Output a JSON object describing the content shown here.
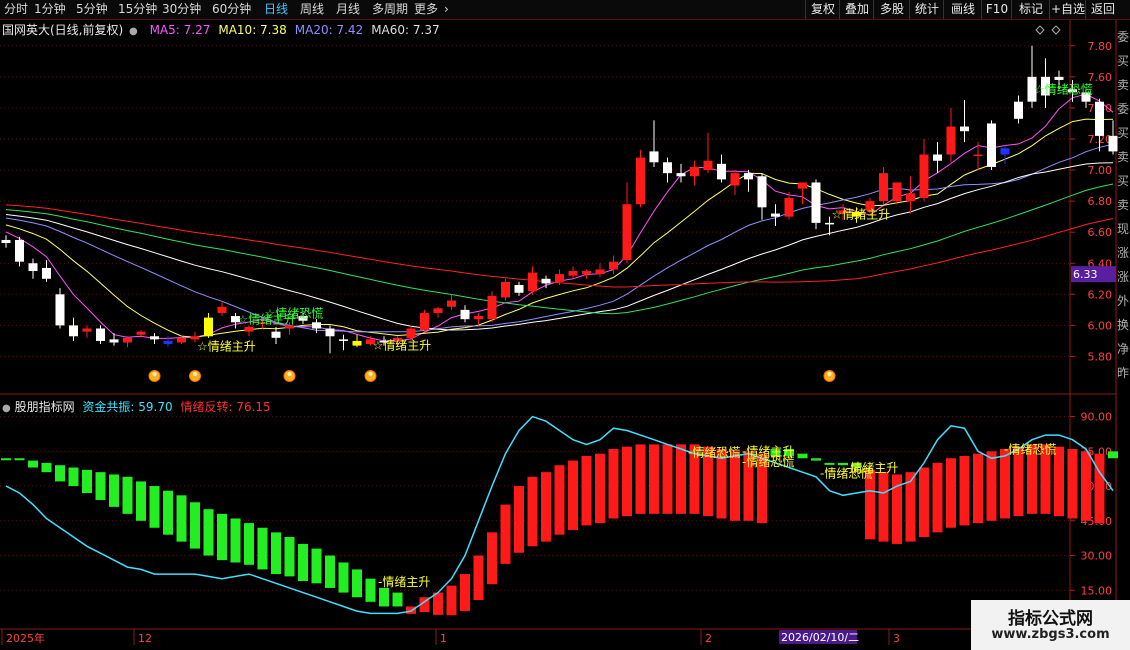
{
  "toolbar": {
    "periods": [
      {
        "label": "分时",
        "active": false
      },
      {
        "label": "1分钟",
        "active": false
      },
      {
        "label": "5分钟",
        "active": false
      },
      {
        "label": "15分钟",
        "active": false
      },
      {
        "label": "30分钟",
        "active": false
      },
      {
        "label": "60分钟",
        "active": false
      },
      {
        "label": "日线",
        "active": true
      },
      {
        "label": "周线",
        "active": false
      },
      {
        "label": "月线",
        "active": false
      },
      {
        "label": "多周期",
        "active": false
      },
      {
        "label": "更多",
        "active": false
      }
    ],
    "more_chevron": "›",
    "actions": [
      "复权",
      "叠加",
      "多股",
      "统计",
      "画线",
      "F10",
      "标记",
      "+自选",
      "返回"
    ]
  },
  "main_chart": {
    "stock_name": "国网英大(日线,前复权)",
    "ma_labels": [
      {
        "text": "MA5: 7.27",
        "color": "#ff55ff"
      },
      {
        "text": "MA10: 7.38",
        "color": "#ffff66"
      },
      {
        "text": "MA20: 7.42",
        "color": "#8f8fff"
      },
      {
        "text": "MA60: 7.37",
        "color": "#dddddd"
      }
    ],
    "price_ticks": [
      "7.80",
      "7.60",
      "7.40",
      "7.20",
      "7.00",
      "6.80",
      "6.60",
      "6.40",
      "6.20",
      "6.00",
      "5.80"
    ],
    "current_price": "6.33",
    "signals": {
      "rise": "情绪主升",
      "panic": "情绪恐慌"
    }
  },
  "indicator": {
    "name": "股朋指标网",
    "line1": {
      "text": "资金共振: 59.70",
      "color": "#40e0ff"
    },
    "line2": {
      "text": "情绪反转: 76.15",
      "color": "#ff3030"
    },
    "ticks": [
      "90.00",
      "75.00",
      "60.00",
      "45.00",
      "30.00",
      "15.00"
    ],
    "signals": {
      "rise": "情绪主升",
      "panic": "情绪恐慌"
    }
  },
  "date_axis": {
    "labels": [
      "2025年",
      "12",
      "1",
      "2",
      "3"
    ],
    "cursor_date": "2026/02/10/二"
  },
  "right_strip_text": [
    "委",
    "买",
    "卖",
    "委",
    "买",
    "卖",
    "买",
    "卖",
    "现",
    "涨",
    "涨",
    "外",
    "换",
    "净",
    "昨"
  ],
  "watermark": {
    "line1": "指标公式网",
    "line2": "www.zbgs3.com"
  },
  "chart_data": {
    "type": "candlestick",
    "ohlc_approx": [
      [
        6.55,
        6.58,
        6.5,
        6.53
      ],
      [
        6.55,
        6.57,
        6.38,
        6.41
      ],
      [
        6.4,
        6.43,
        6.3,
        6.35
      ],
      [
        6.37,
        6.42,
        6.28,
        6.3
      ],
      [
        6.2,
        6.24,
        5.98,
        6.0
      ],
      [
        6.0,
        6.05,
        5.9,
        5.93
      ],
      [
        5.96,
        6.0,
        5.92,
        5.98
      ],
      [
        5.98,
        6.0,
        5.88,
        5.9
      ],
      [
        5.91,
        5.95,
        5.87,
        5.89
      ],
      [
        5.89,
        5.93,
        5.86,
        5.92
      ],
      [
        5.94,
        5.97,
        5.93,
        5.96
      ],
      [
        5.93,
        5.95,
        5.88,
        5.91
      ],
      [
        5.88,
        5.93,
        5.86,
        5.9
      ],
      [
        5.89,
        5.93,
        5.88,
        5.92
      ],
      [
        5.91,
        5.96,
        5.89,
        5.93
      ],
      [
        5.93,
        6.08,
        5.92,
        6.05
      ],
      [
        6.08,
        6.15,
        6.06,
        6.12
      ],
      [
        6.06,
        6.08,
        5.98,
        6.02
      ],
      [
        5.96,
        6.0,
        5.93,
        5.99
      ],
      [
        6.01,
        6.04,
        5.98,
        6.02
      ],
      [
        5.96,
        5.99,
        5.88,
        5.92
      ],
      [
        5.98,
        6.02,
        5.94,
        6.0
      ],
      [
        6.06,
        6.08,
        6.01,
        6.03
      ],
      [
        6.02,
        6.04,
        5.95,
        5.98
      ],
      [
        5.98,
        6.0,
        5.82,
        5.93
      ],
      [
        5.91,
        5.94,
        5.84,
        5.9
      ],
      [
        5.9,
        5.94,
        5.86,
        5.87
      ],
      [
        5.88,
        5.93,
        5.87,
        5.91
      ],
      [
        5.9,
        5.93,
        5.87,
        5.89
      ],
      [
        5.9,
        5.93,
        5.87,
        5.92
      ],
      [
        5.92,
        6.0,
        5.9,
        5.98
      ],
      [
        5.97,
        6.1,
        5.96,
        6.08
      ],
      [
        6.08,
        6.12,
        6.05,
        6.11
      ],
      [
        6.12,
        6.2,
        6.1,
        6.16
      ],
      [
        6.1,
        6.13,
        6.02,
        6.04
      ],
      [
        6.04,
        6.08,
        6.0,
        6.06
      ],
      [
        6.04,
        6.22,
        6.02,
        6.19
      ],
      [
        6.18,
        6.3,
        6.16,
        6.28
      ],
      [
        6.26,
        6.28,
        6.19,
        6.21
      ],
      [
        6.22,
        6.38,
        6.2,
        6.34
      ],
      [
        6.3,
        6.32,
        6.24,
        6.27
      ],
      [
        6.28,
        6.36,
        6.26,
        6.33
      ],
      [
        6.32,
        6.38,
        6.3,
        6.35
      ],
      [
        6.33,
        6.36,
        6.3,
        6.35
      ],
      [
        6.33,
        6.4,
        6.31,
        6.36
      ],
      [
        6.36,
        6.45,
        6.33,
        6.41
      ],
      [
        6.42,
        6.92,
        6.4,
        6.78
      ],
      [
        6.78,
        7.13,
        6.76,
        7.08
      ],
      [
        7.12,
        7.32,
        7.02,
        7.05
      ],
      [
        7.05,
        7.08,
        6.92,
        6.98
      ],
      [
        6.98,
        7.04,
        6.92,
        6.96
      ],
      [
        6.96,
        7.06,
        6.9,
        7.02
      ],
      [
        7.0,
        7.24,
        6.98,
        7.06
      ],
      [
        7.04,
        7.1,
        6.92,
        6.94
      ],
      [
        6.9,
        7.0,
        6.84,
        6.98
      ],
      [
        6.98,
        7.0,
        6.86,
        6.94
      ],
      [
        6.96,
        6.98,
        6.68,
        6.76
      ],
      [
        6.72,
        6.78,
        6.64,
        6.7
      ],
      [
        6.7,
        6.86,
        6.68,
        6.82
      ],
      [
        6.88,
        6.92,
        6.78,
        6.92
      ],
      [
        6.92,
        6.94,
        6.62,
        6.66
      ],
      [
        6.66,
        6.7,
        6.58,
        6.65
      ],
      [
        6.72,
        6.78,
        6.68,
        6.74
      ],
      [
        6.73,
        6.76,
        6.66,
        6.7
      ],
      [
        6.74,
        6.82,
        6.72,
        6.8
      ],
      [
        6.8,
        7.02,
        6.78,
        6.98
      ],
      [
        6.8,
        6.92,
        6.78,
        6.92
      ],
      [
        6.8,
        6.96,
        6.72,
        6.85
      ],
      [
        6.82,
        7.2,
        6.8,
        7.1
      ],
      [
        7.1,
        7.18,
        6.98,
        7.06
      ],
      [
        7.1,
        7.4,
        7.05,
        7.28
      ],
      [
        7.28,
        7.45,
        7.18,
        7.25
      ],
      [
        7.1,
        7.18,
        7.0,
        7.1
      ],
      [
        7.3,
        7.32,
        7.0,
        7.02
      ],
      [
        7.1,
        7.16,
        7.04,
        7.14
      ],
      [
        7.44,
        7.48,
        7.3,
        7.33
      ],
      [
        7.6,
        7.8,
        7.4,
        7.44
      ],
      [
        7.6,
        7.72,
        7.4,
        7.48
      ],
      [
        7.6,
        7.64,
        7.52,
        7.58
      ],
      [
        7.52,
        7.58,
        7.44,
        7.5
      ],
      [
        7.5,
        7.52,
        7.4,
        7.44
      ],
      [
        7.44,
        7.46,
        7.12,
        7.22
      ],
      [
        7.22,
        7.32,
        7.1,
        7.12
      ]
    ],
    "ma_last": {
      "MA5": 7.27,
      "MA10": 7.38,
      "MA20": 7.42,
      "MA60": 7.37
    },
    "indicator_last": {
      "资金共振": 59.7,
      "情绪反转": 76.15
    },
    "y_range_price": [
      5.7,
      7.85
    ],
    "y_range_indicator": [
      0,
      95
    ]
  }
}
